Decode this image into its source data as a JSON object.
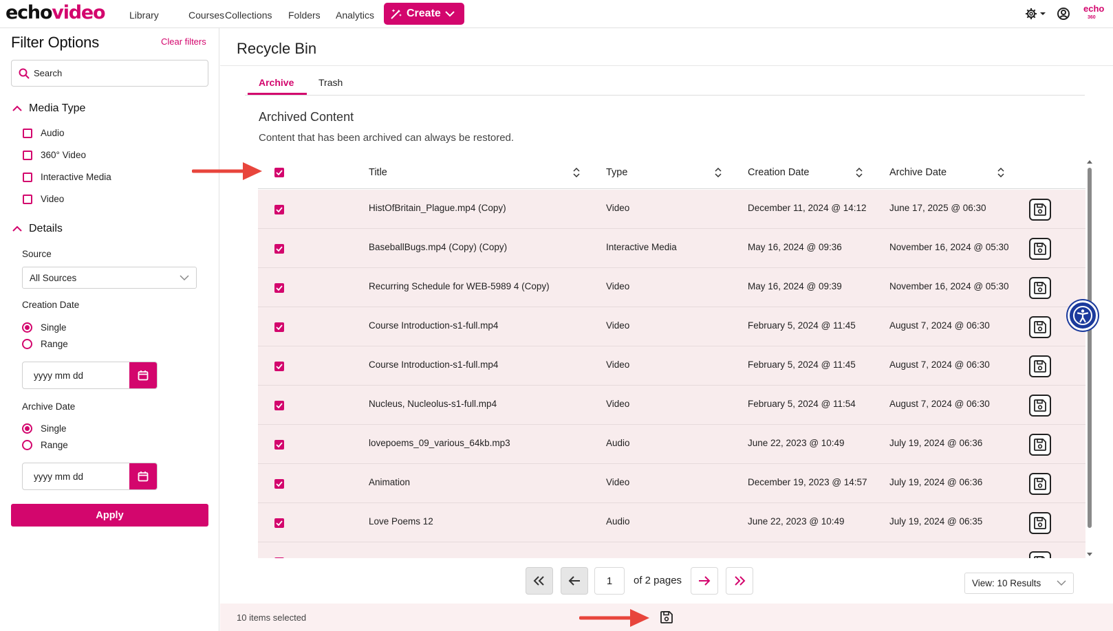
{
  "brand": {
    "logo_part1": "echo",
    "logo_part2": "video"
  },
  "nav": {
    "items": [
      "Library",
      "Courses",
      "Collections",
      "Folders",
      "Analytics"
    ],
    "create_label": "Create"
  },
  "top_icons": [
    "gear-icon",
    "user-icon",
    "echo360-logo"
  ],
  "echo360": {
    "line1": "echo",
    "line2": "360"
  },
  "filters": {
    "title": "Filter Options",
    "clear_label": "Clear filters",
    "search_placeholder": "Search",
    "media_type": {
      "title": "Media Type",
      "options": [
        "Audio",
        "360° Video",
        "Interactive Media",
        "Video"
      ]
    },
    "details": {
      "title": "Details",
      "source_label": "Source",
      "source_value": "All Sources",
      "creation_date_label": "Creation Date",
      "archive_date_label": "Archive Date",
      "single_label": "Single",
      "range_label": "Range",
      "date_placeholder": "yyyy mm dd"
    },
    "apply_label": "Apply"
  },
  "main": {
    "title": "Recycle Bin",
    "tabs": [
      {
        "label": "Archive",
        "active": true
      },
      {
        "label": "Trash",
        "active": false
      }
    ],
    "section_title": "Archived Content",
    "section_desc": "Content that has been archived can always be restored."
  },
  "table": {
    "columns": [
      "Title",
      "Type",
      "Creation Date",
      "Archive Date"
    ],
    "rows": [
      {
        "title": "HistOfBritain_Plague.mp4 (Copy)",
        "type": "Video",
        "created": "December 11, 2024 @ 14:12",
        "archived": "June 17, 2025 @ 06:30"
      },
      {
        "title": "BaseballBugs.mp4 (Copy) (Copy)",
        "type": "Interactive Media",
        "created": "May 16, 2024 @ 09:36",
        "archived": "November 16, 2024 @ 05:30"
      },
      {
        "title": "Recurring Schedule for WEB-5989 4 (Copy)",
        "type": "Video",
        "created": "May 16, 2024 @ 09:39",
        "archived": "November 16, 2024 @ 05:30"
      },
      {
        "title": "Course Introduction-s1-full.mp4",
        "type": "Video",
        "created": "February 5, 2024 @ 11:45",
        "archived": "August 7, 2024 @ 06:30"
      },
      {
        "title": "Course Introduction-s1-full.mp4",
        "type": "Video",
        "created": "February 5, 2024 @ 11:45",
        "archived": "August 7, 2024 @ 06:30"
      },
      {
        "title": "Nucleus, Nucleolus-s1-full.mp4",
        "type": "Video",
        "created": "February 5, 2024 @ 11:54",
        "archived": "August 7, 2024 @ 06:30"
      },
      {
        "title": "lovepoems_09_various_64kb.mp3",
        "type": "Audio",
        "created": "June 22, 2023 @ 10:49",
        "archived": "July 19, 2024 @ 06:36"
      },
      {
        "title": "Animation",
        "type": "Video",
        "created": "December 19, 2023 @ 14:57",
        "archived": "July 19, 2024 @ 06:36"
      },
      {
        "title": "Love Poems 12",
        "type": "Audio",
        "created": "June 22, 2023 @ 10:49",
        "archived": "July 19, 2024 @ 06:35"
      }
    ],
    "partial_row_index": 10
  },
  "pager": {
    "page": "1",
    "of_label": "of 2 pages",
    "view_label": "View: 10 Results"
  },
  "footer": {
    "selected_text": "10 items selected"
  },
  "colors": {
    "accent": "#d3066d",
    "row_bg": "#f8eced",
    "annotation_arrow": "#e8453c",
    "a11y": "#1b3a9c"
  }
}
